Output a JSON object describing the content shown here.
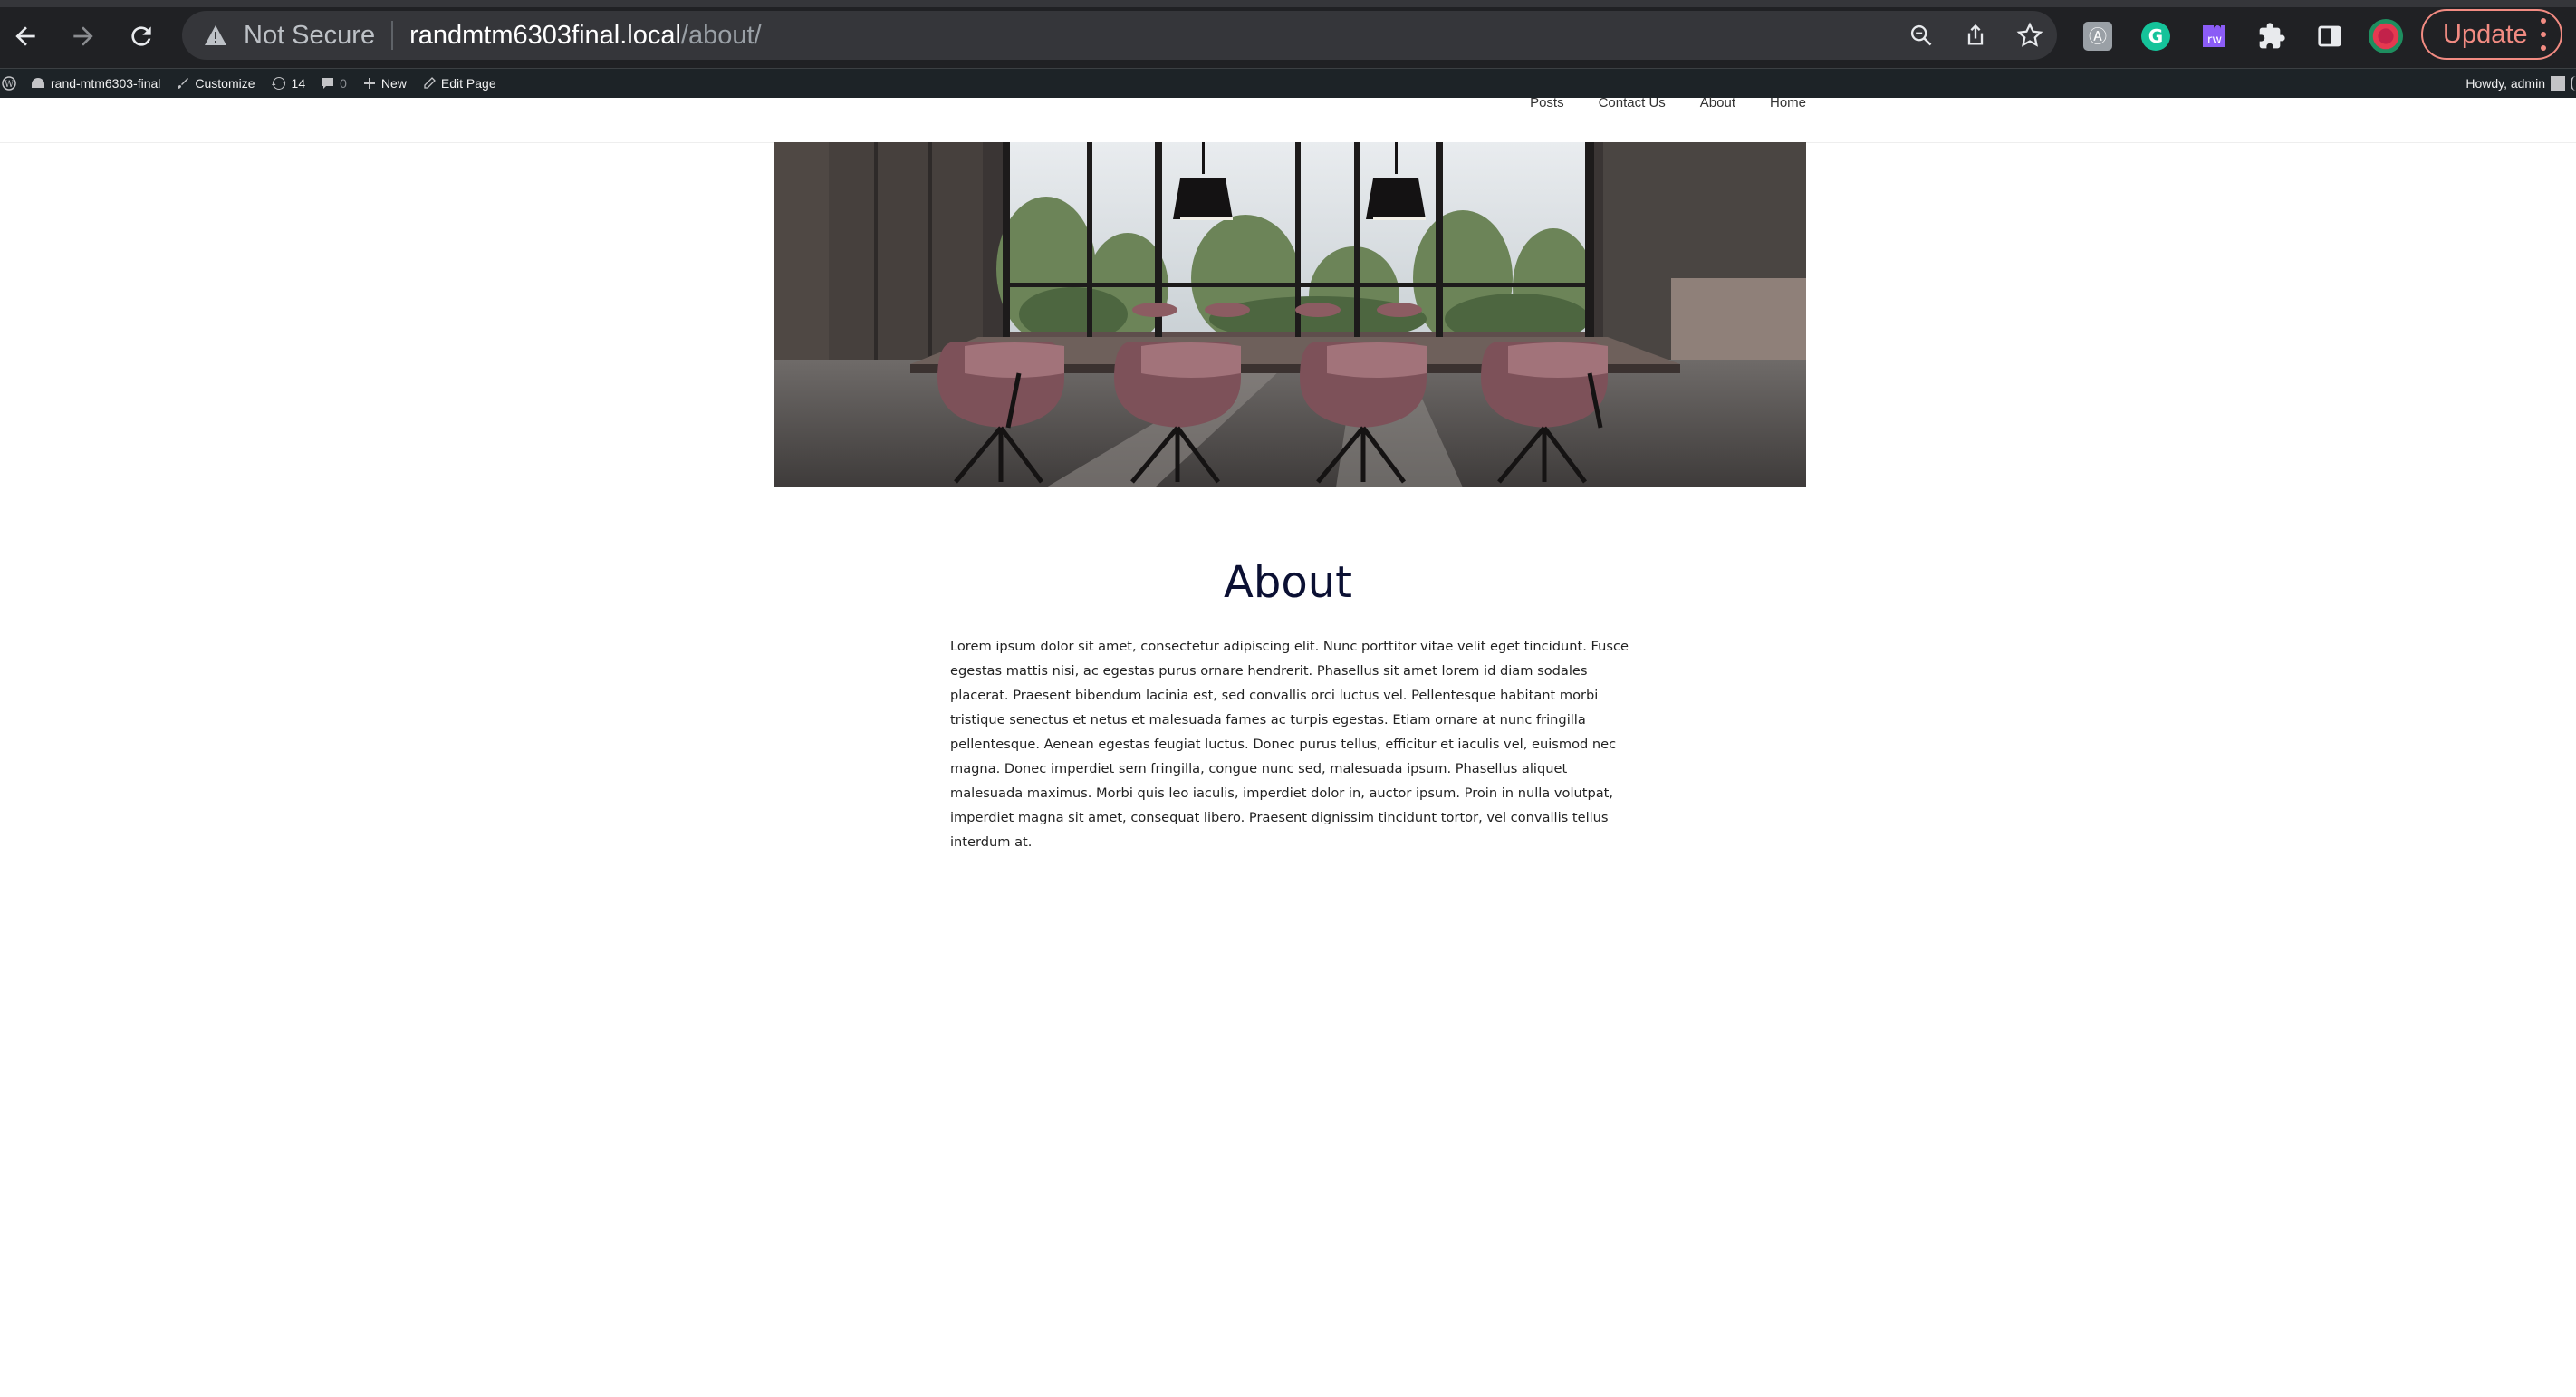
{
  "browser": {
    "security_label": "Not Secure",
    "url_host": "randmtm6303final.local",
    "url_path": "/about/",
    "update_label": "Update",
    "toolbar_icons": [
      "zoom-icon",
      "share-icon",
      "bookmark-star-icon"
    ],
    "extension_icons": [
      "extension-generic-icon",
      "grammarly-icon",
      "rw-extension-icon",
      "puzzle-extensions-icon",
      "side-panel-icon",
      "profile-avatar-icon"
    ]
  },
  "adminbar": {
    "site_name": "rand-mtm6303-final",
    "customize": "Customize",
    "updates_count": "14",
    "comments_count": "0",
    "new_label": "New",
    "edit_label": "Edit Page",
    "howdy": "Howdy, admin"
  },
  "site_nav": {
    "items": [
      "Posts",
      "Contact Us",
      "About",
      "Home"
    ]
  },
  "page": {
    "title": "About",
    "body": "Lorem ipsum dolor sit amet, consectetur adipiscing elit. Nunc porttitor vitae velit eget tincidunt. Fusce egestas mattis nisi, ac egestas purus ornare hendrerit. Phasellus sit amet lorem id diam sodales placerat. Praesent bibendum lacinia est, sed convallis orci luctus vel. Pellentesque habitant morbi tristique senectus et netus et malesuada fames ac turpis egestas. Etiam ornare at nunc fringilla pellentesque. Aenean egestas feugiat luctus. Donec purus tellus, efficitur et iaculis vel, euismod nec magna. Donec imperdiet sem fringilla, congue nunc sed, malesuada ipsum. Phasellus aliquet malesuada maximus. Morbi quis leo iaculis, imperdiet dolor in, auctor ipsum. Proin in nulla volutpat, imperdiet magna sit amet, consequat libero. Praesent dignissim tincidunt tortor, vel convallis tellus interdum at."
  }
}
